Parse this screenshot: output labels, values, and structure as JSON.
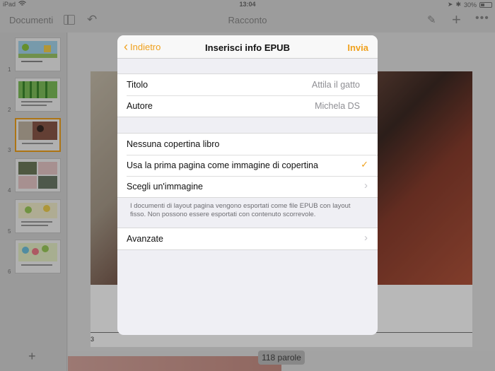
{
  "status_bar": {
    "device": "iPad",
    "wifi_icon": "wifi-icon",
    "time": "13:04",
    "battery": "30%",
    "battery_level": 0.3
  },
  "toolbar": {
    "documents_label": "Documenti",
    "title": "Racconto",
    "plus_label": "+",
    "more_label": "•••"
  },
  "navigator": {
    "pages": [
      "1",
      "2",
      "3",
      "4",
      "5",
      "6"
    ],
    "selected_page": "3",
    "add_label": "+"
  },
  "canvas": {
    "page_number": "3",
    "word_count": "118 parole"
  },
  "modal": {
    "back_label": "Indietro",
    "title": "Inserisci info EPUB",
    "send_label": "Invia",
    "fields": [
      {
        "label": "Titolo",
        "value": "Attila il gatto"
      },
      {
        "label": "Autore",
        "value": "Michela DS"
      }
    ],
    "cover_options": [
      {
        "label": "Nessuna copertina libro"
      },
      {
        "label": "Usa la prima pagina come immagine di copertina",
        "checked": true
      },
      {
        "label": "Scegli un'immagine"
      }
    ],
    "note": "I documenti di layout pagina vengono esportati come file EPUB con layout fisso. Non possono essere esportati con contenuto scorrevole.",
    "advanced_label": "Avanzate"
  },
  "colors": {
    "accent": "#f0a11c",
    "modal_background": "#efeff4",
    "secondary_text": "#8e8e93"
  }
}
